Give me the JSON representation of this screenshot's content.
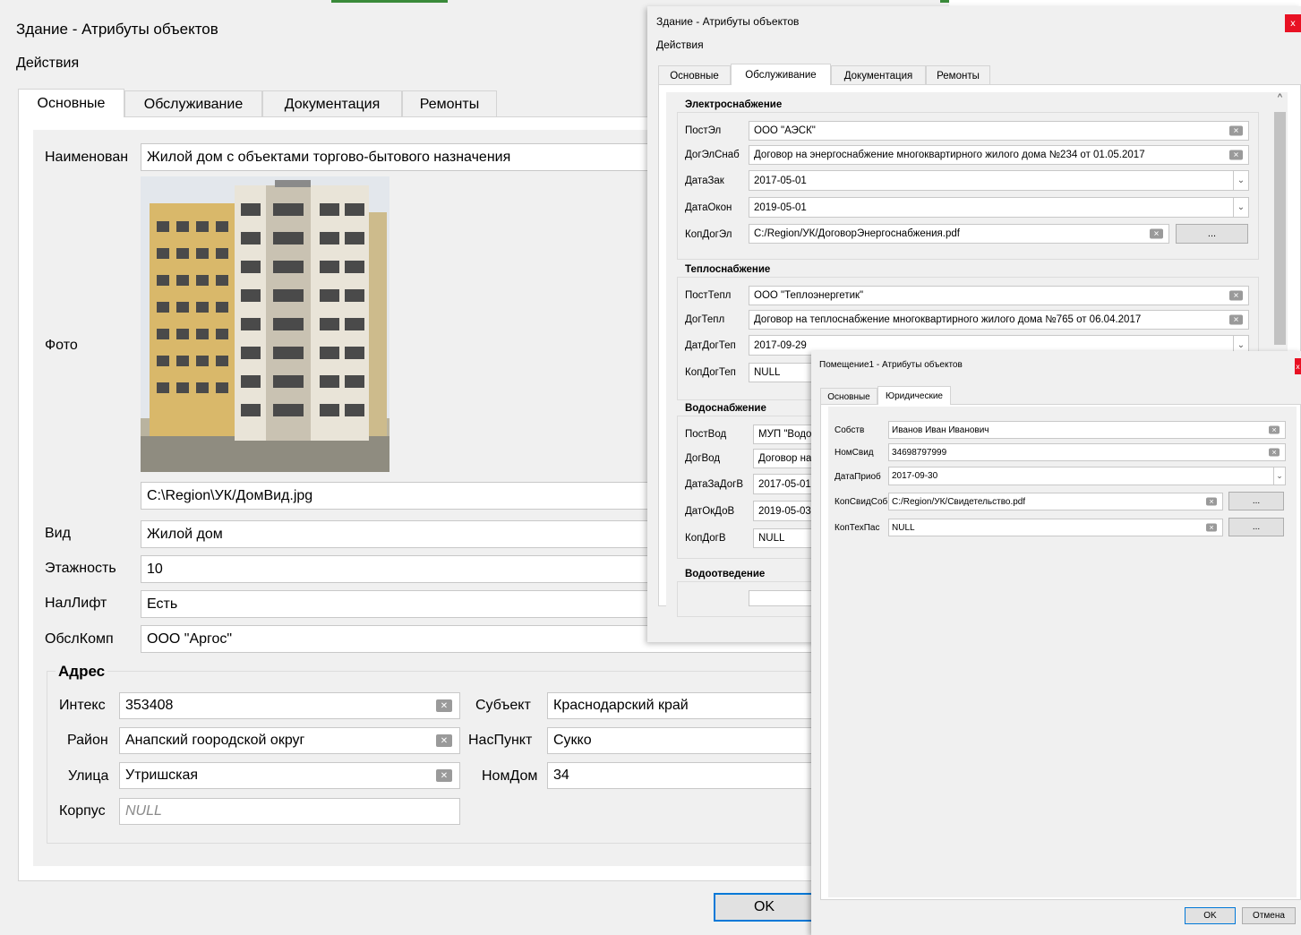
{
  "w1": {
    "title": "Здание - Атрибуты объектов",
    "menu": "Действия",
    "tabs": [
      "Основные",
      "Обслуживание",
      "Документация",
      "Ремонты"
    ],
    "labels": {
      "name": "Наименован",
      "photo": "Фото",
      "type": "Вид",
      "floors": "Этажность",
      "lift": "НалЛифт",
      "company": "ОбслКомп"
    },
    "values": {
      "name": "Жилой дом с объектами торгово-бытового назначения",
      "photo_path": "C:\\Region\\УК/ДомВид.jpg",
      "type": "Жилой дом",
      "floors": "10",
      "lift": "Есть",
      "company": "ООО \"Аргос\""
    },
    "address": {
      "title": "Адрес",
      "index_label": "Интекс",
      "index": "353408",
      "subject_label": "Субъект",
      "subject": "Краснодарский край",
      "district_label": "Район",
      "district": "Анапский гоородской округ",
      "settlement_label": "НасПункт",
      "settlement": "Сукко",
      "street_label": "Улица",
      "street": "Утришская",
      "house_label": "НомДом",
      "house": "34",
      "building_label": "Корпус",
      "building": "NULL"
    },
    "ok": "OK"
  },
  "w2": {
    "title": "Здание - Атрибуты объектов",
    "menu": "Действия",
    "close": "x",
    "tabs": [
      "Основные",
      "Обслуживание",
      "Документация",
      "Ремонты"
    ],
    "power": {
      "title": "Электроснабжение",
      "supplier_label": "ПостЭл",
      "supplier": "ООО \"АЭСК\"",
      "contract_label": "ДогЭлСнаб",
      "contract": "Договор на энергоснабжение многоквартирного жилого дома №234 от 01.05.2017",
      "date_from_label": "ДатаЗак",
      "date_from": "2017-05-01",
      "date_to_label": "ДатаОкон",
      "date_to": "2019-05-01",
      "copy_label": "КопДогЭл",
      "copy": "C:/Region/УК/ДоговорЭнергоснабжения.pdf",
      "browse": "..."
    },
    "heat": {
      "title": "Теплоснабжение",
      "supplier_label": "ПостТепл",
      "supplier": "ООО \"Теплоэнергетик\"",
      "contract_label": "ДогТепл",
      "contract": "Договор на теплоснабжение многоквартирного жилого дома №765 от 06.04.2017",
      "date_label": "ДатДогТеп",
      "date": "2017-09-29",
      "copy_label": "КопДогТеп",
      "copy": "NULL"
    },
    "water": {
      "title": "Водоснабжение",
      "supplier_label": "ПостВод",
      "supplier": "МУП \"Водо",
      "contract_label": "ДогВод",
      "contract": "Договор на",
      "date_from_label": "ДатаЗаДогВ",
      "date_from": "2017-05-01",
      "date_to_label": "ДатОкДоВ",
      "date_to": "2019-05-03",
      "copy_label": "КопДогВ",
      "copy": "NULL"
    },
    "sewer": {
      "title": "Водоотведение"
    },
    "scroll_up": "^"
  },
  "w3": {
    "title": "Помещение1 - Атрибуты объектов",
    "close": "x",
    "tabs": [
      "Основные",
      "Юридические"
    ],
    "owner_label": "Собств",
    "owner": "Иванов Иван Иванович",
    "cert_label": "НомСвид",
    "cert": "34698797999",
    "date_label": "ДатаПриоб",
    "date": "2017-09-30",
    "cert_copy_label": "КопСвидСоб",
    "cert_copy": "C:/Region/УК/Свидетельство.pdf",
    "passport_label": "КопТехПас",
    "passport": "NULL",
    "browse": "...",
    "ok": "OK",
    "cancel": "Отмена"
  }
}
